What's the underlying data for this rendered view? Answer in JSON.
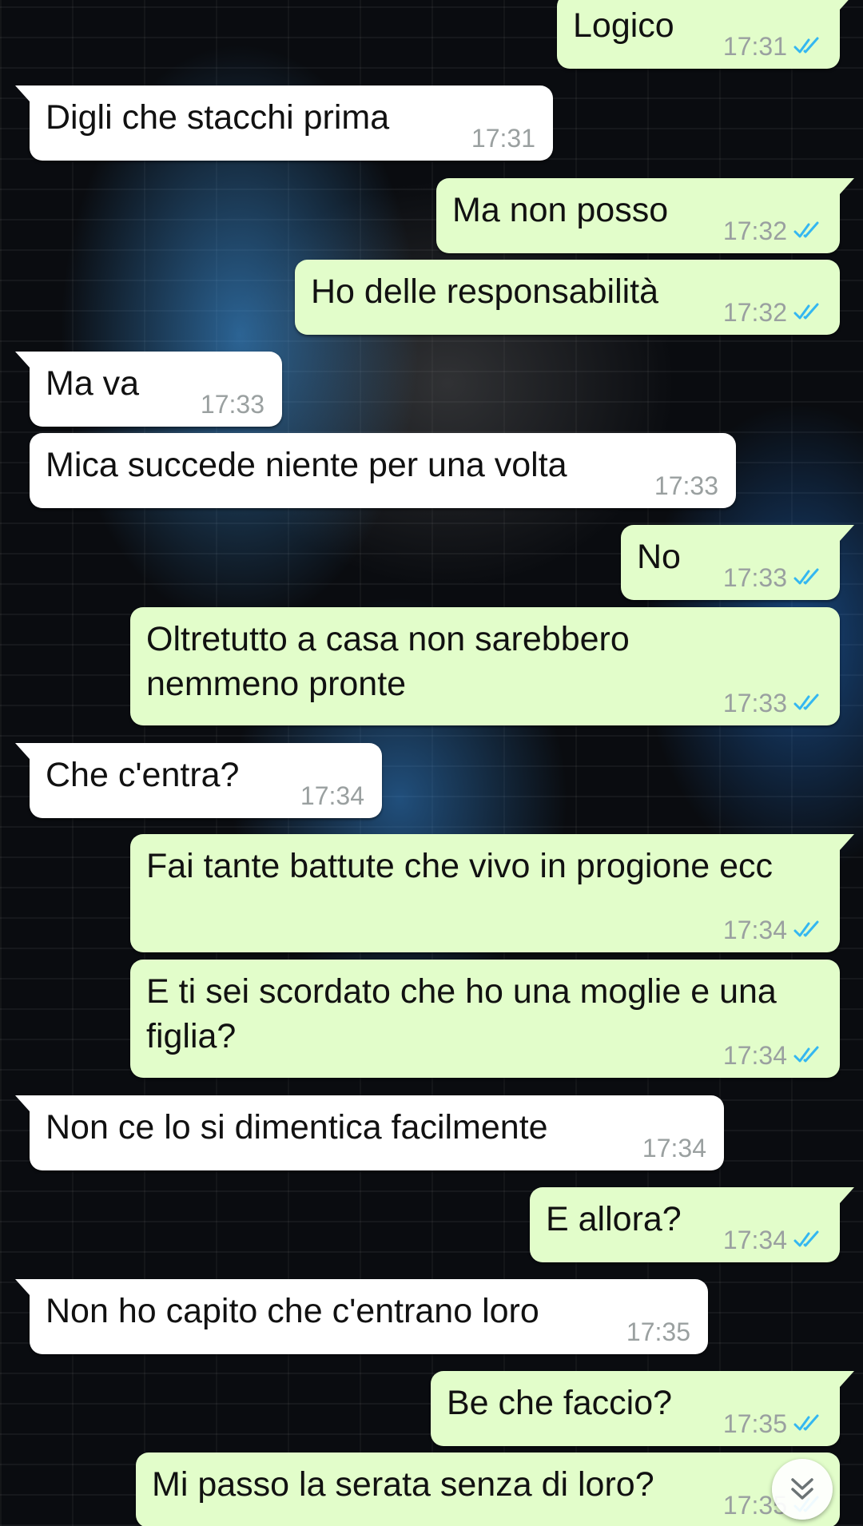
{
  "colors": {
    "incoming_bubble": "#ffffff",
    "outgoing_bubble": "#e2fdca",
    "timestamp": "#9aa0a0",
    "read_check": "#34b7f1"
  },
  "messages": [
    {
      "direction": "out",
      "text": "Logico",
      "time": "17:31",
      "status": "read-check-icon"
    },
    {
      "direction": "in",
      "text": "Digli che stacchi prima",
      "time": "17:31"
    },
    {
      "direction": "out",
      "text": "Ma non posso",
      "time": "17:32",
      "status": "read-check-icon"
    },
    {
      "direction": "out",
      "text": "Ho delle responsabilità",
      "time": "17:32",
      "status": "read-check-icon"
    },
    {
      "direction": "in",
      "text": "Ma va",
      "time": "17:33"
    },
    {
      "direction": "in",
      "text": "Mica succede niente per una volta",
      "time": "17:33"
    },
    {
      "direction": "out",
      "text": "No",
      "time": "17:33",
      "status": "read-check-icon"
    },
    {
      "direction": "out",
      "text": "Oltretutto a casa non sarebbero nemmeno pronte",
      "time": "17:33",
      "status": "read-check-icon"
    },
    {
      "direction": "in",
      "text": "Che c'entra?",
      "time": "17:34"
    },
    {
      "direction": "out",
      "text": "Fai tante battute che vivo in progione ecc",
      "time": "17:34",
      "status": "read-check-icon"
    },
    {
      "direction": "out",
      "text": "E ti sei scordato che ho una moglie e una figlia?",
      "time": "17:34",
      "status": "read-check-icon"
    },
    {
      "direction": "in",
      "text": "Non ce lo si dimentica facilmente",
      "time": "17:34"
    },
    {
      "direction": "out",
      "text": "E allora?",
      "time": "17:34",
      "status": "read-check-icon"
    },
    {
      "direction": "in",
      "text": "Non ho capito che c'entrano loro",
      "time": "17:35"
    },
    {
      "direction": "out",
      "text": "Be che faccio?",
      "time": "17:35",
      "status": "read-check-icon"
    },
    {
      "direction": "out",
      "text": "Mi passo la serata senza di loro?",
      "time": "17:35",
      "status": "read-check-icon"
    }
  ],
  "scroll_button": {
    "icon": "double-chevron-down-icon"
  }
}
